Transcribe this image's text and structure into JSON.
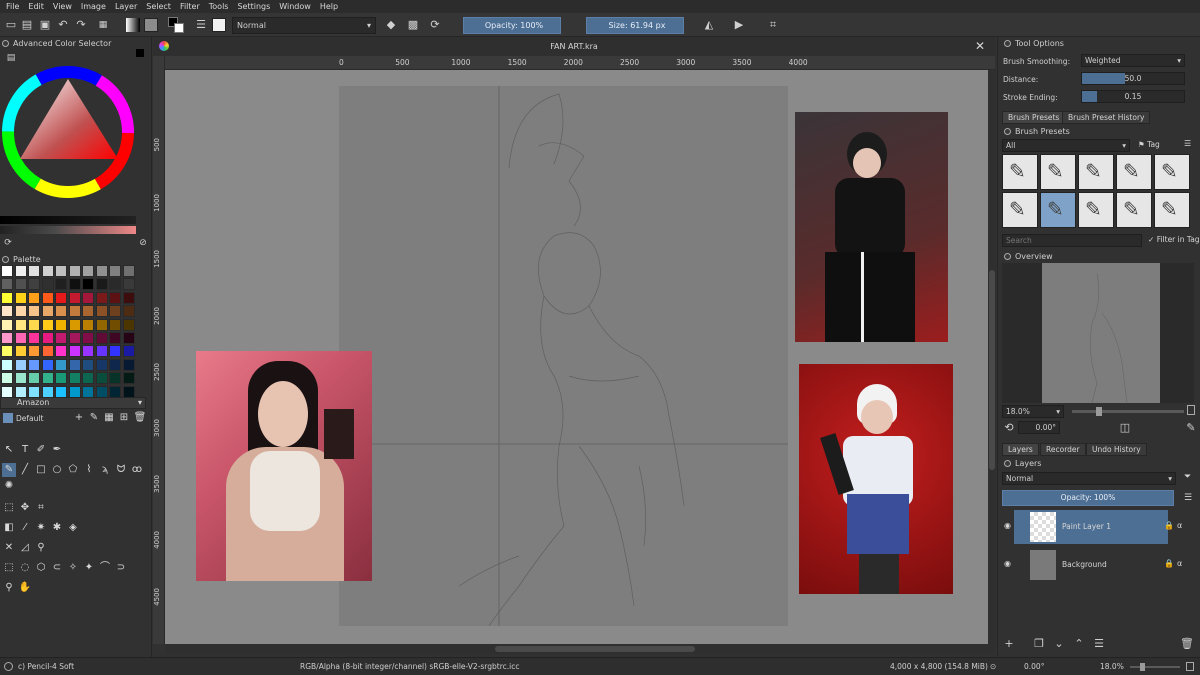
{
  "menu": [
    "File",
    "Edit",
    "View",
    "Image",
    "Layer",
    "Select",
    "Filter",
    "Tools",
    "Settings",
    "Window",
    "Help"
  ],
  "toolbar": {
    "blend_mode": "Normal",
    "opacity": "Opacity: 100%",
    "size": "Size: 61.94 px"
  },
  "left_docker": {
    "color_selector_title": "Advanced Color Selector",
    "palette_title": "Palette",
    "palette_name": "Amazon",
    "preset_name": "Default",
    "palette_colors": [
      [
        "#ffffff",
        "#f0f0f0",
        "#e0e0e0",
        "#d0d0d0",
        "#c0c0c0",
        "#b0b0b0",
        "#a0a0a0",
        "#909090",
        "#808080",
        "#707070"
      ],
      [
        "#606060",
        "#505050",
        "#404040",
        "#303030",
        "#202020",
        "#101010",
        "#000000",
        "#1a1a1a",
        "#2a2a2a",
        "#3a3a3a"
      ],
      [
        "#ffff33",
        "#ffd21a",
        "#ff9f1a",
        "#ff5a1a",
        "#e61a1a",
        "#c21a2e",
        "#a3173a",
        "#7a1a1a",
        "#5c1212",
        "#3d0d0d"
      ],
      [
        "#ffe6c8",
        "#ffd6a8",
        "#f5c28a",
        "#e8a968",
        "#d9904d",
        "#c27a3d",
        "#a86530",
        "#8c5226",
        "#6e401d",
        "#4d2c13"
      ],
      [
        "#fff2b3",
        "#ffe680",
        "#ffd94d",
        "#ffcc1a",
        "#f0b400",
        "#d99a00",
        "#b87f00",
        "#946600",
        "#704d00",
        "#4d3500"
      ],
      [
        "#ff99cc",
        "#ff66b3",
        "#ff3399",
        "#e61a80",
        "#c21a6e",
        "#a3175c",
        "#800d47",
        "#600a36",
        "#400724",
        "#260415"
      ],
      [
        "#ffff66",
        "#ffcc33",
        "#ff9933",
        "#ff6633",
        "#ff33cc",
        "#cc33ff",
        "#9933ff",
        "#6633ff",
        "#3333ff",
        "#1a1aa3"
      ],
      [
        "#ccffff",
        "#99ccff",
        "#6699ff",
        "#3366ff",
        "#3399cc",
        "#3366aa",
        "#1f4d80",
        "#173866",
        "#0f264d",
        "#081a33"
      ],
      [
        "#ccffe6",
        "#99e6cc",
        "#66ccaa",
        "#33b38c",
        "#1a9977",
        "#138063",
        "#0d664f",
        "#0a4d3c",
        "#073328",
        "#041a14"
      ],
      [
        "#e6ffff",
        "#b3f0ff",
        "#80e0ff",
        "#4dd0ff",
        "#1ac0ff",
        "#0099cc",
        "#007399",
        "#004d66",
        "#002633",
        "#00131a"
      ]
    ]
  },
  "document": {
    "tab_title": "FAN ART.kra",
    "hruler_ticks": [
      "0",
      "500",
      "1000",
      "1500",
      "2000",
      "2500",
      "3000",
      "3500",
      "4000"
    ],
    "vruler_ticks": [
      "500",
      "1000",
      "1500",
      "2000",
      "2500",
      "3000",
      "3500",
      "4000",
      "4500"
    ]
  },
  "right_docker": {
    "tool_options_title": "Tool Options",
    "brush_smoothing_label": "Brush Smoothing:",
    "brush_smoothing_value": "Weighted",
    "distance_label": "Distance:",
    "distance_value": "50.0",
    "distance_fraction": 0.42,
    "stroke_ending_label": "Stroke Ending:",
    "stroke_ending_value": "0.15",
    "stroke_ending_fraction": 0.15,
    "tab_brush_presets": "Brush Presets",
    "tab_brush_history": "Brush Preset History",
    "brush_presets_title": "Brush Presets",
    "filter_all": "All",
    "tag_label": "Tag",
    "search_placeholder": "Search",
    "filter_in_tag": "Filter in Tag",
    "overview_title": "Overview",
    "zoom_value": "18.0%",
    "rotation_value": "0.00°",
    "tab_layers": "Layers",
    "tab_recorder": "Recorder",
    "tab_undo_history": "Undo History",
    "layers_title": "Layers",
    "layer_blend_mode": "Normal",
    "layer_opacity": "Opacity: 100%",
    "layers": [
      {
        "name": "Paint Layer 1",
        "selected": true
      },
      {
        "name": "Background",
        "selected": false
      }
    ]
  },
  "status_bar": {
    "brush": "c) Pencil-4 Soft",
    "color_model": "RGB/Alpha (8-bit integer/channel)  sRGB-elle-V2-srgbtrc.icc",
    "dimensions": "4,000 x 4,800 (154.8 MiB)",
    "rotation": "0.00°",
    "zoom": "18.0%"
  }
}
